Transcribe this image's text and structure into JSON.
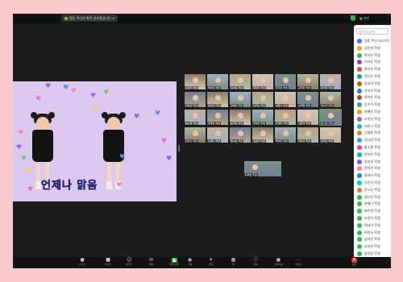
{
  "window": {
    "share_label": "정동 주인의 화면 공유중입니다",
    "view_label": "보기 옵션",
    "top_right_label": "보기"
  },
  "main_video": {
    "caption": "언제나 맑음",
    "heart_colors": [
      "#9b59f0",
      "#5a8cf0",
      "#ff7fb8",
      "#f06bd6",
      "#8a6cf5",
      "#63d37a",
      "#ffcf4a"
    ]
  },
  "gallery": {
    "tiles": [
      {
        "name": "김민지 학생"
      },
      {
        "name": "박하은 학생"
      },
      {
        "name": "이서윤 학생"
      },
      {
        "name": "최지우 학생"
      },
      {
        "name": "정다은 학생"
      },
      {
        "name": "강지아 학생"
      },
      {
        "name": "윤서연 학생"
      },
      {
        "name": "장하윤 학생"
      },
      {
        "name": "임수아 학생"
      },
      {
        "name": "한예린 학생"
      },
      {
        "name": "오지민 학생"
      },
      {
        "name": "서유나 학생"
      },
      {
        "name": "신채원 학생"
      },
      {
        "name": "권나연 학생"
      },
      {
        "name": "황소율 학생"
      },
      {
        "name": "안아린 학생"
      },
      {
        "name": "송지유 학생"
      },
      {
        "name": "전하린 학생"
      },
      {
        "name": "홍세아 학생"
      },
      {
        "name": "고은서 학생"
      },
      {
        "name": "문시은 학생"
      },
      {
        "name": "양다인 학생"
      },
      {
        "name": "손예나 학생"
      },
      {
        "name": "배수빈 학생"
      },
      {
        "name": "조윤아 학생"
      },
      {
        "name": "백서아 학생"
      },
      {
        "name": "허민서 학생"
      },
      {
        "name": "남지안 학생"
      },
      {
        "name": "유하연 학생"
      }
    ],
    "active_index": 20
  },
  "participants_panel": {
    "search_placeholder": "참가자 검색",
    "items": [
      {
        "name": "정동 주인 (호스트)",
        "color": "#4a6cf7"
      },
      {
        "name": "김민지 학생",
        "color": "#f0a33b"
      },
      {
        "name": "박하은 학생",
        "color": "#2fb84d"
      },
      {
        "name": "이서윤 학생",
        "color": "#8e44ad"
      },
      {
        "name": "최지우 학생",
        "color": "#e74c3c"
      },
      {
        "name": "정다은 학생",
        "color": "#16a085"
      },
      {
        "name": "강지아 학생",
        "color": "#d35400"
      },
      {
        "name": "윤서연 학생",
        "color": "#2980b9"
      },
      {
        "name": "장하윤 학생",
        "color": "#c0392b"
      },
      {
        "name": "임수아 학생",
        "color": "#27ae60"
      },
      {
        "name": "한예린 학생",
        "color": "#f39c12"
      },
      {
        "name": "오지민 학생",
        "color": "#9b59b6"
      },
      {
        "name": "서유나 학생",
        "color": "#1abc9c"
      },
      {
        "name": "신채원 학생",
        "color": "#e67e22"
      },
      {
        "name": "권나연 학생",
        "color": "#3498db"
      },
      {
        "name": "황소율 학생",
        "color": "#e84393"
      },
      {
        "name": "안아린 학생",
        "color": "#00b894"
      },
      {
        "name": "송지유 학생",
        "color": "#6c5ce7"
      },
      {
        "name": "전하린 학생",
        "color": "#fd79a8"
      },
      {
        "name": "홍세아 학생",
        "color": "#0984e3"
      },
      {
        "name": "고은서 학생",
        "color": "#00cec9"
      },
      {
        "name": "문시은 학생",
        "color": "#e17055"
      },
      {
        "name": "양다인 학생",
        "color": "#2fb84d"
      },
      {
        "name": "손예나 학생",
        "color": "#2fb84d"
      },
      {
        "name": "배수빈 학생",
        "color": "#2fb84d"
      },
      {
        "name": "조윤아 학생",
        "color": "#2fb84d"
      },
      {
        "name": "백서아 학생",
        "color": "#2fb84d"
      },
      {
        "name": "허민서 학생",
        "color": "#2fb84d"
      },
      {
        "name": "남지안 학생",
        "color": "#2fb84d"
      },
      {
        "name": "유하연 학생",
        "color": "#2fb84d"
      },
      {
        "name": "송하은 학생",
        "color": "#2fb84d"
      }
    ],
    "footer_button": "초대"
  },
  "toolbar": {
    "buttons": [
      {
        "label": "오디오",
        "icon": "microphone-icon"
      },
      {
        "label": "비디오",
        "icon": "camera-icon"
      },
      {
        "label": "참가자",
        "icon": "participants-icon"
      },
      {
        "label": "채팅",
        "icon": "chat-icon"
      },
      {
        "label": "화면 공유",
        "icon": "share-screen-icon"
      },
      {
        "label": "기록",
        "icon": "record-icon"
      },
      {
        "label": "반응",
        "icon": "reactions-icon"
      },
      {
        "label": "앱",
        "icon": "apps-icon"
      },
      {
        "label": "정보",
        "icon": "info-icon"
      },
      {
        "label": "소회의실",
        "icon": "breakout-icon"
      },
      {
        "label": "더보기",
        "icon": "more-icon"
      },
      {
        "label": "종료",
        "icon": "end-icon"
      }
    ]
  }
}
